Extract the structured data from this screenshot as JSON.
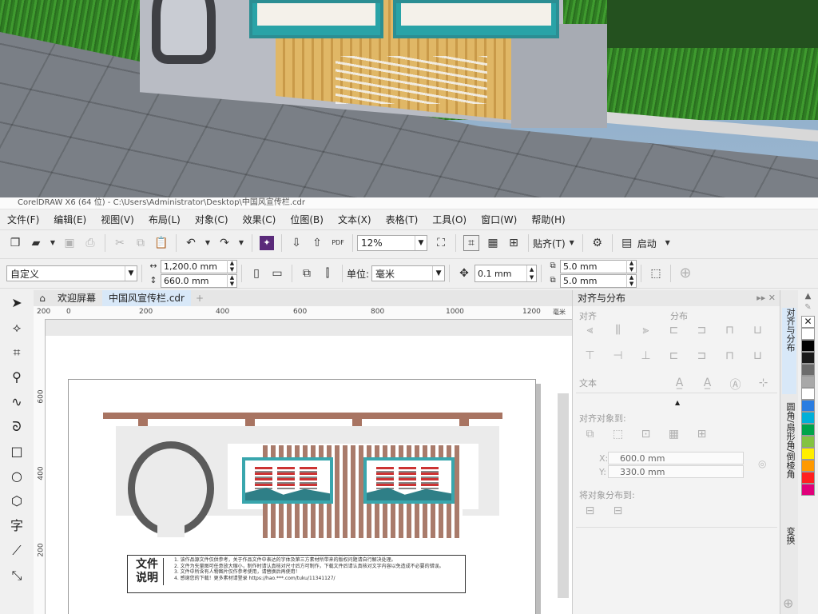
{
  "window": {
    "titlebar": "CorelDRAW X6 (64 位) - C:\\Users\\Administrator\\Desktop\\中国风宣传栏.cdr"
  },
  "menu": [
    "文件(F)",
    "编辑(E)",
    "视图(V)",
    "布局(L)",
    "对象(C)",
    "效果(C)",
    "位图(B)",
    "文本(X)",
    "表格(T)",
    "工具(O)",
    "窗口(W)",
    "帮助(H)"
  ],
  "toolbar": {
    "zoom_value": "12%",
    "snap_label": "贴齐(T)",
    "launch_label": "启动"
  },
  "property_bar": {
    "page_preset": "自定义",
    "page_width": "1,200.0 mm",
    "page_height": "660.0 mm",
    "units_label": "单位:",
    "units_value": "毫米",
    "nudge": "0.1 mm",
    "dup_x": "5.0 mm",
    "dup_y": "5.0 mm"
  },
  "tabs": [
    {
      "label": "欢迎屏幕"
    },
    {
      "label": "中国风宣传栏.cdr"
    }
  ],
  "rulers": {
    "h_unit": "毫米",
    "h_ticks": [
      "200",
      "0",
      "200",
      "400",
      "600",
      "800",
      "1000",
      "1200"
    ],
    "v_ticks": [
      "600",
      "400",
      "200"
    ]
  },
  "document": {
    "notes_title": "文件说明",
    "notes_lines": [
      "1. 该作品源文件仅供参考，关于作品文件中表达的字体及第三方素材所带来的版权问题请自行解决处理。",
      "2. 文件为矢量图可任意放大缩小，制作时请认真核对尺寸后方可制作，下载文件后请认真核对文字内容以免造成不必要的错误。",
      "3. 文件中所含有人物图片仅作参考使用，请替换后再使用！",
      "4. 感谢您的下载！更多素材请登录 https://hao.***.com/tuku/11341127/"
    ]
  },
  "docker": {
    "title": "对齐与分布",
    "align_label": "对齐",
    "distribute_label": "分布",
    "text_label": "文本",
    "align_to_label": "对齐对象到:",
    "x_label": "X:",
    "x_value": "600.0 mm",
    "y_label": "Y:",
    "y_value": "330.0 mm",
    "distribute_to_label": "将对象分布到:"
  },
  "vertical_tabs": [
    "对齐与分布",
    "圆角/扇形角/倒棱角",
    "变换"
  ],
  "palette": [
    "#ffffff",
    "#000000",
    "#1a1a1a",
    "#6c6c6c",
    "#a8a8a8",
    "#ffffff",
    "#2a7de1",
    "#00b0d8",
    "#00a44a",
    "#83c341",
    "#ffee00",
    "#ff9900",
    "#ff2020",
    "#e0007a"
  ]
}
